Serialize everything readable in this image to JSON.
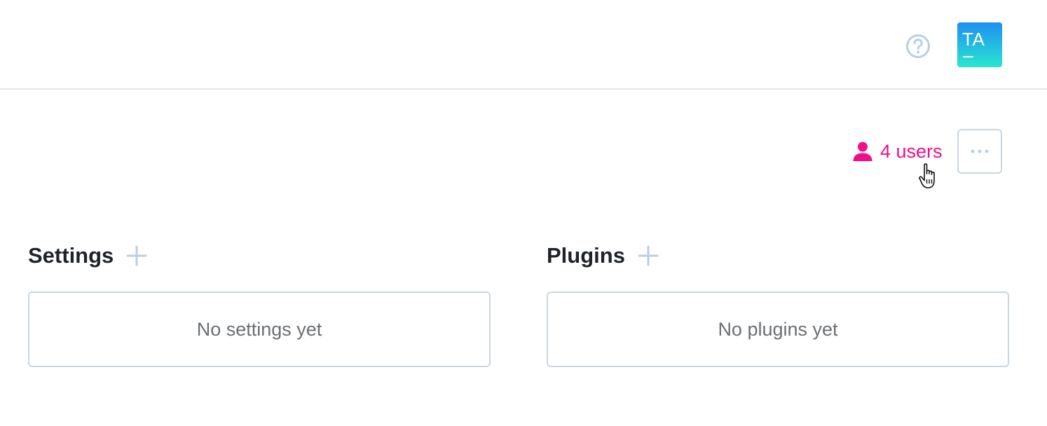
{
  "header": {
    "help_icon": "question-circle-icon",
    "avatar": {
      "initials": "TA",
      "gradient_top": "#1e8ff2",
      "gradient_bottom": "#2ae6cf"
    }
  },
  "actions": {
    "users_icon": "user-icon",
    "users_label": "4 users",
    "users_color": "#ef0f8c",
    "more_icon": "ellipsis-icon"
  },
  "sections": {
    "settings": {
      "title": "Settings",
      "add_icon": "plus-icon",
      "empty_text": "No settings yet"
    },
    "plugins": {
      "title": "Plugins",
      "add_icon": "plus-icon",
      "empty_text": "No plugins yet"
    }
  },
  "colors": {
    "muted_icon": "#b9cfe4",
    "border": "#c9d6e2",
    "accent": "#ef0f8c"
  }
}
